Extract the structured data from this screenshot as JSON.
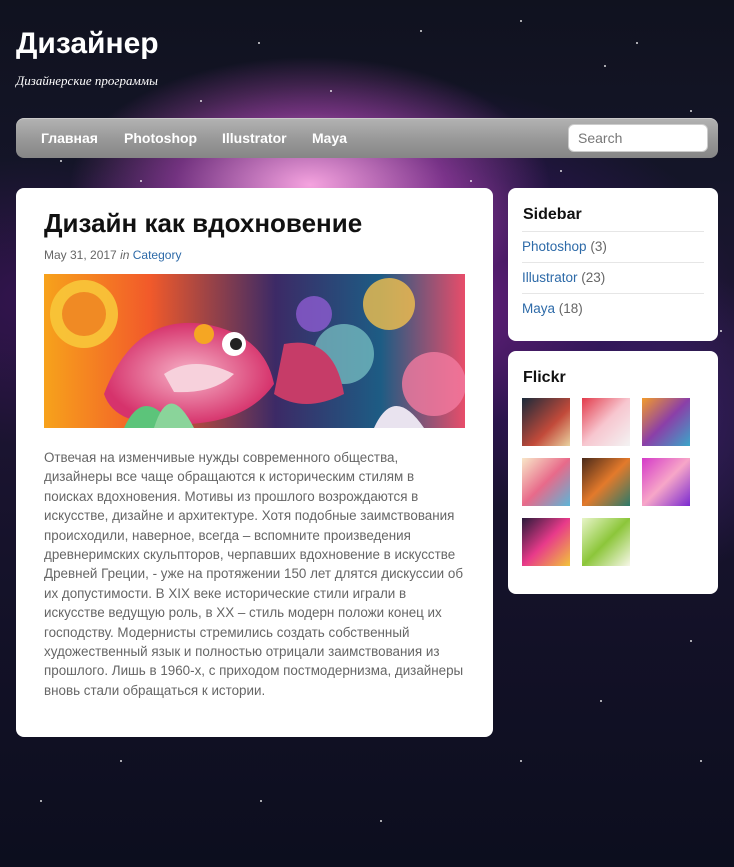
{
  "site": {
    "title": "Дизайнер",
    "description": "Дизайнерские программы"
  },
  "nav": {
    "items": [
      "Главная",
      "Photoshop",
      "Illustrator",
      "Maya"
    ],
    "search_placeholder": "Search"
  },
  "post": {
    "title": "Дизайн как вдохновение",
    "date": "May 31, 2017",
    "in_label": "in",
    "category": "Category",
    "image_icon": "colorful-koi-fish-illustration",
    "body": "Отвечая на изменчивые нужды современного общества, дизайнеры все чаще обращаются к историческим стилям в поисках вдохновения. Мотивы из прошлого возрождаются в искусстве, дизайне и архитектуре. Хотя подобные заимствования происходили, наверное, всегда – вспомните произведения древнеримских скульпторов, черпавших вдохновение в искусстве Древней Греции, - уже на протяжении 150 лет длятся дискуссии об их допустимости. В XIX веке исторические стили играли в искусстве ведущую роль, в XX – стиль модерн положи конец их господству. Модернисты стремились создать собственный художественный язык и полностью отрицали заимствования из прошлого. Лишь в 1960-х, с приходом постмодернизма, дизайнеры вновь стали обращаться к истории."
  },
  "sidebar": {
    "title": "Sidebar",
    "items": [
      {
        "label": "Photoshop",
        "count": "(3)"
      },
      {
        "label": "Illustrator",
        "count": "(23)"
      },
      {
        "label": "Maya",
        "count": "(18)"
      }
    ]
  },
  "flickr": {
    "title": "Flickr",
    "thumb_count": 8
  },
  "colors": {
    "link": "#2d6aa8",
    "navbar": "#9a9a9a",
    "card": "#ffffff",
    "body_text": "#666666"
  }
}
